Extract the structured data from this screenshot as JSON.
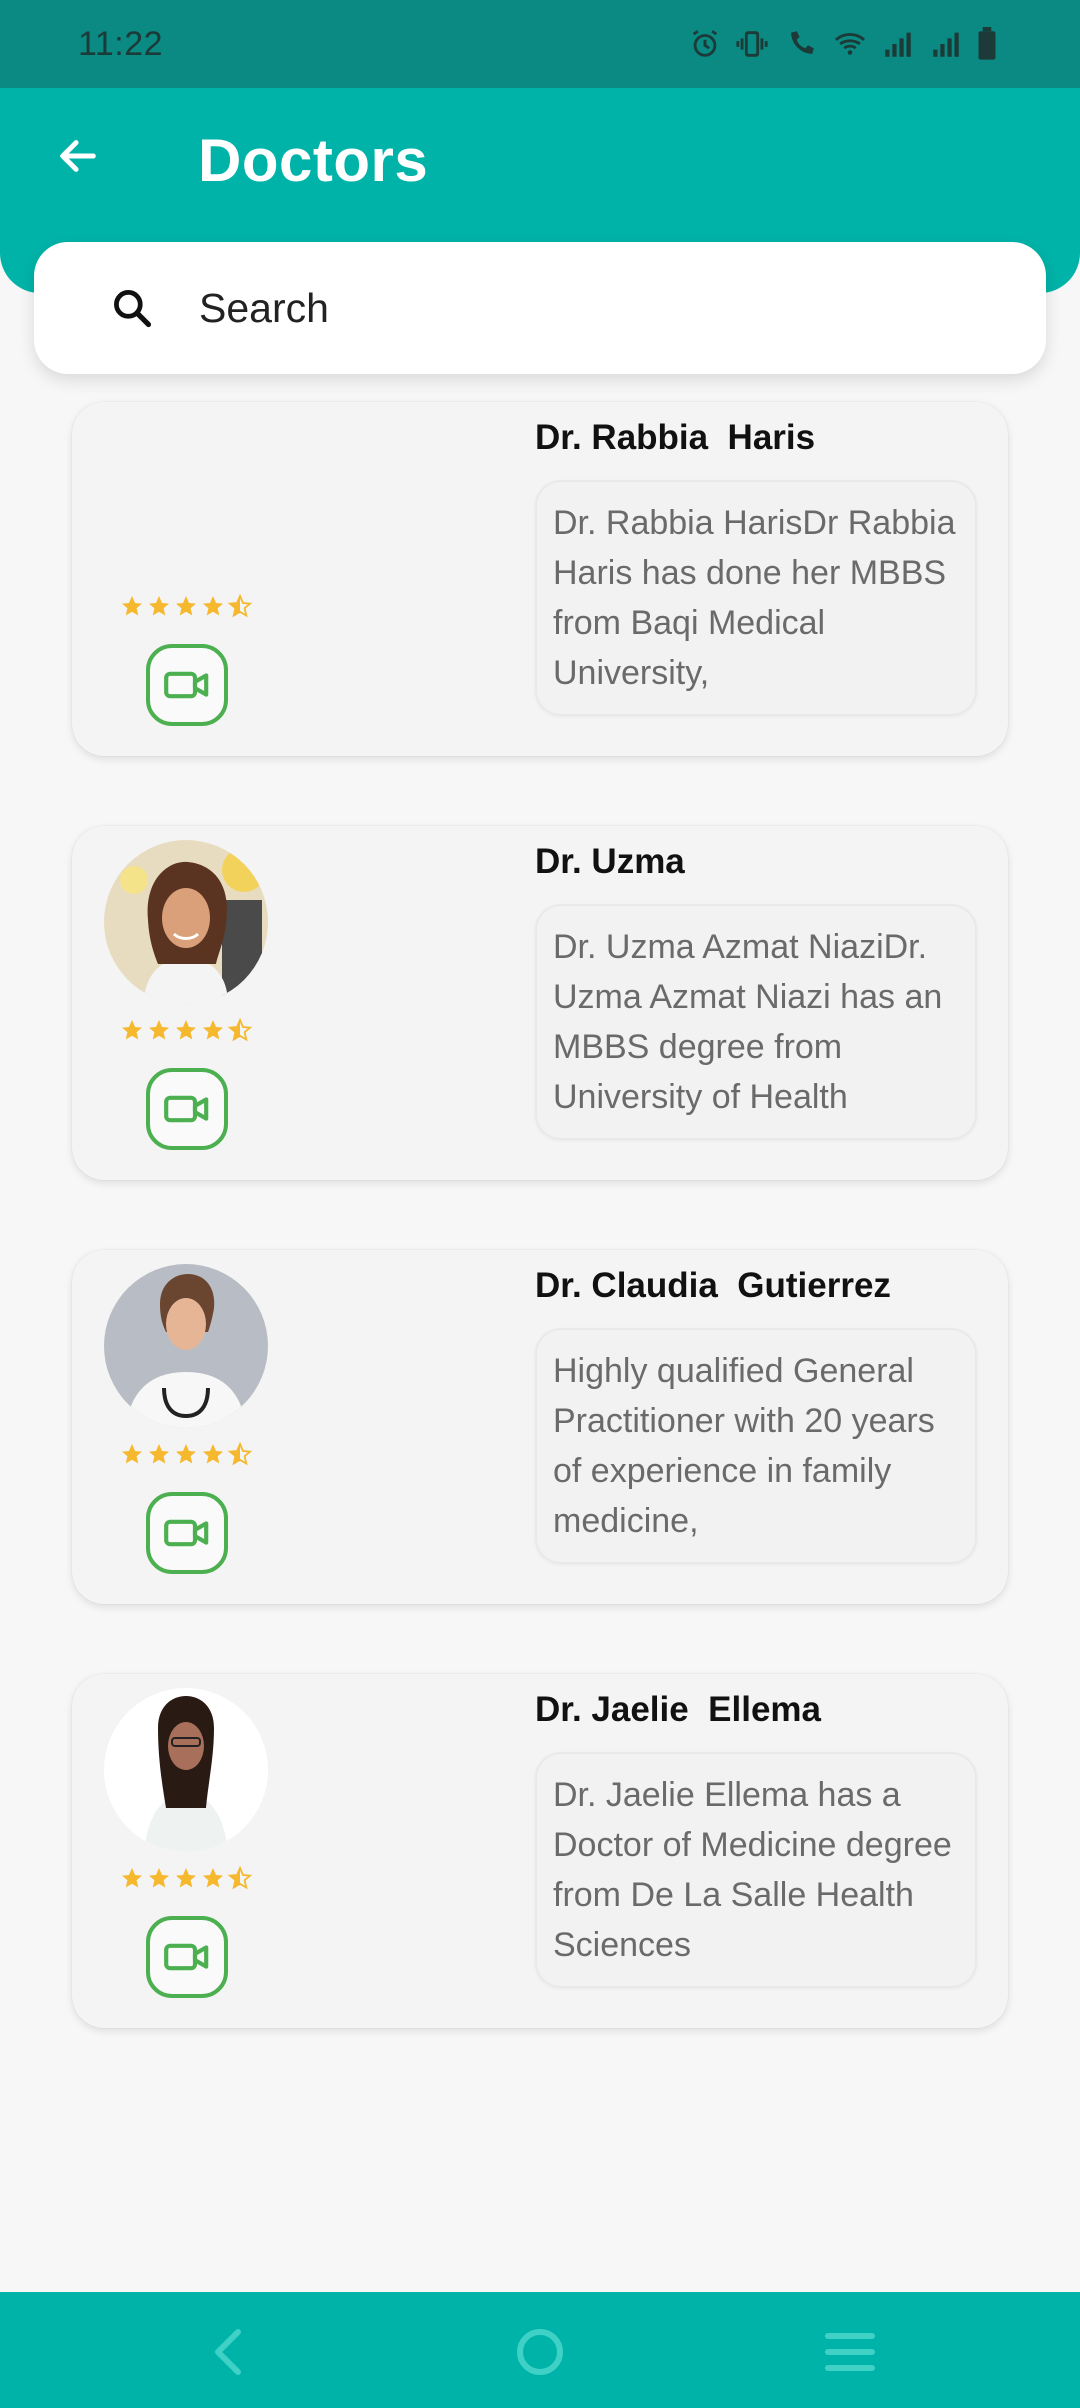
{
  "status_bar": {
    "time": "11:22"
  },
  "header": {
    "title": "Doctors",
    "back_icon": "arrow-left-icon"
  },
  "search": {
    "placeholder": "Search",
    "value": ""
  },
  "doctors": [
    {
      "name": "Dr. Rabbia  Haris",
      "description": "Dr. Rabbia HarisDr Rabbia Haris has done her MBBS from Baqi Medical University,",
      "rating": 4.5,
      "has_photo": false
    },
    {
      "name": "Dr. Uzma",
      "description": "Dr. Uzma Azmat NiaziDr. Uzma Azmat Niazi has an MBBS degree from University of Health",
      "rating": 4.5,
      "has_photo": true
    },
    {
      "name": "Dr. Claudia  Gutierrez",
      "description": "Highly qualified General Practitioner with 20 years of experience in family medicine,",
      "rating": 4.5,
      "has_photo": true
    },
    {
      "name": "Dr. Jaelie  Ellema",
      "description": "Dr. Jaelie Ellema has a Doctor of Medicine degree from De La Salle Health Sciences",
      "rating": 4.5,
      "has_photo": true
    }
  ],
  "colors": {
    "primary": "#00b3a8",
    "status_bar": "#0a8a82",
    "star": "#f5b82e",
    "video_accent": "#4caf50"
  },
  "nav": {
    "back_icon": "nav-back-icon",
    "home_icon": "nav-home-icon",
    "menu_icon": "nav-menu-icon"
  }
}
